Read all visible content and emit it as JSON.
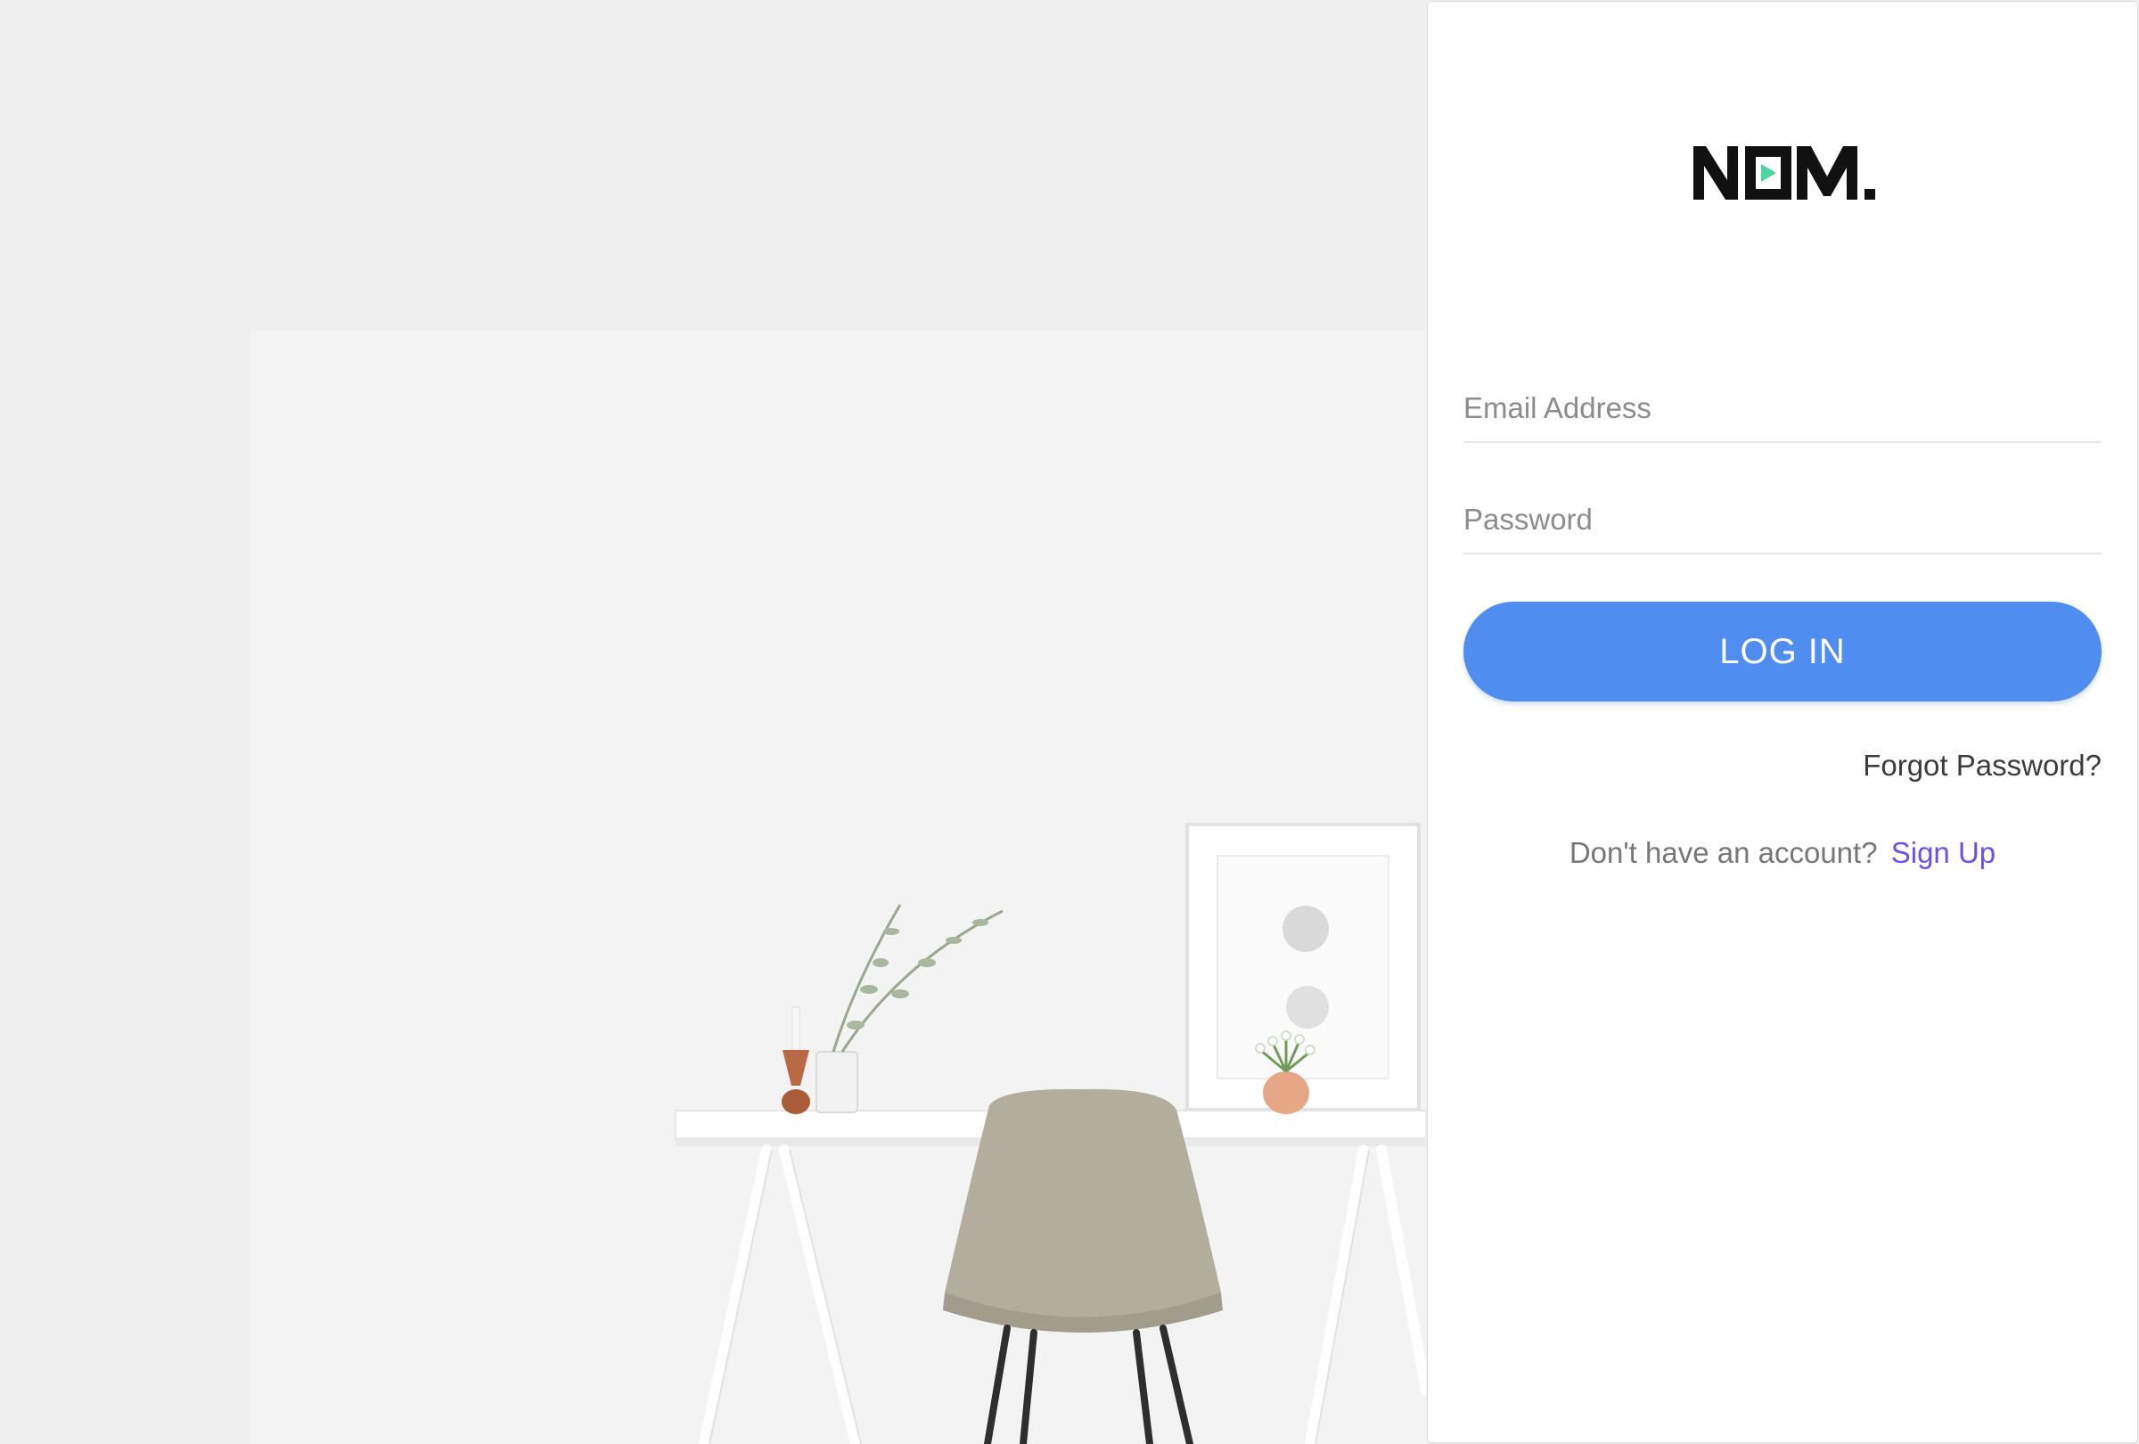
{
  "brand": {
    "name": "NOOM.",
    "accent": "#4ed6a0"
  },
  "form": {
    "email_placeholder": "Email Address",
    "email_value": "",
    "password_placeholder": "Password",
    "password_value": "",
    "login_label": "LOG IN",
    "forgot_label": "Forgot Password?",
    "no_account_text": "Don't have an account?",
    "signup_label": "Sign Up"
  },
  "colors": {
    "button": "#4f8ef0",
    "link": "#6a52e6",
    "background": "#efefef"
  }
}
